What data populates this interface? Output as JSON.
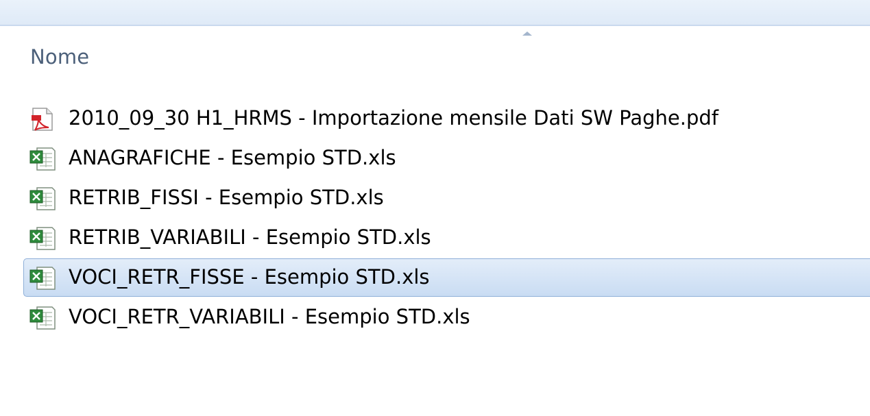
{
  "header": {
    "column_label": "Nome",
    "sort_direction": "ascending"
  },
  "files": [
    {
      "name": "2010_09_30 H1_HRMS - Importazione mensile Dati SW Paghe.pdf",
      "icon": "pdf-icon",
      "selected": false
    },
    {
      "name": "ANAGRAFICHE - Esempio STD.xls",
      "icon": "excel-icon",
      "selected": false
    },
    {
      "name": "RETRIB_FISSI - Esempio STD.xls",
      "icon": "excel-icon",
      "selected": false
    },
    {
      "name": "RETRIB_VARIABILI - Esempio STD.xls",
      "icon": "excel-icon",
      "selected": false
    },
    {
      "name": "VOCI_RETR_FISSE - Esempio STD.xls",
      "icon": "excel-icon",
      "selected": true
    },
    {
      "name": "VOCI_RETR_VARIABILI - Esempio STD.xls",
      "icon": "excel-icon",
      "selected": false
    }
  ],
  "colors": {
    "selection": "#c9dcf3",
    "header_text": "#4c607a"
  }
}
